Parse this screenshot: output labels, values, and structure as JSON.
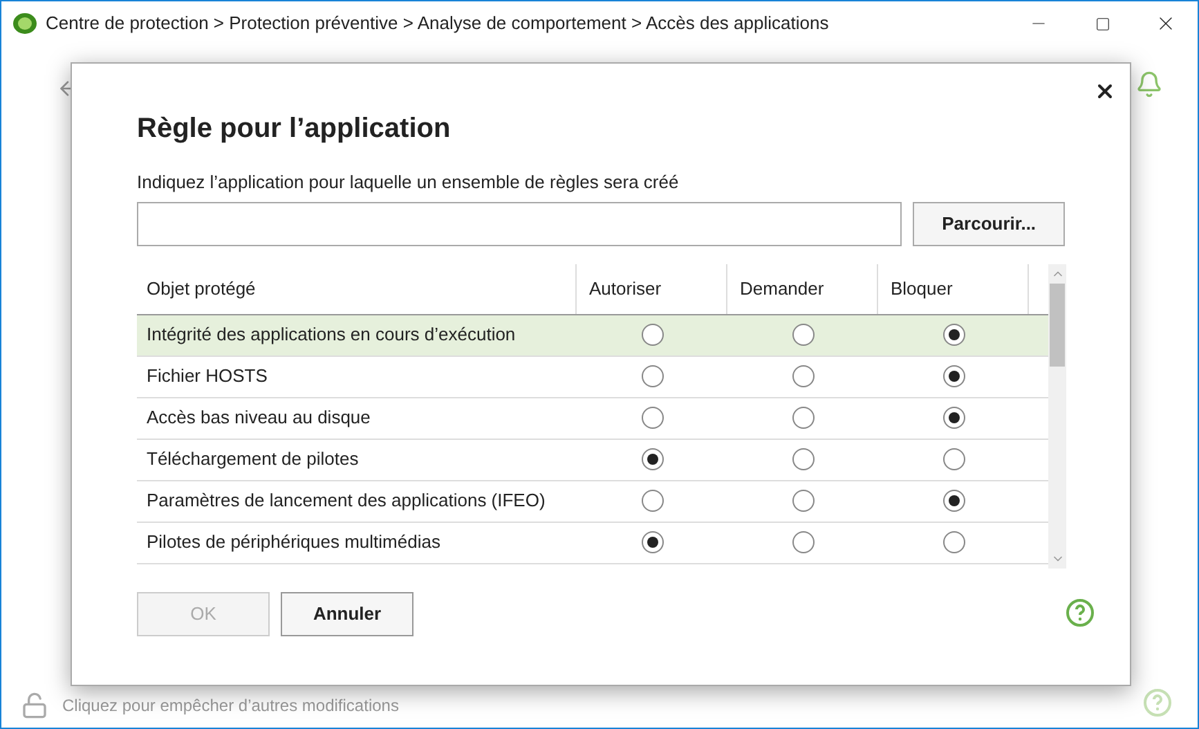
{
  "window": {
    "title": "Centre de protection > Protection préventive > Analyse de comportement > Accès des applications"
  },
  "status_bar": {
    "text": "Cliquez pour empêcher d’autres modifications"
  },
  "dialog": {
    "title": "Règle pour l’application",
    "prompt": "Indiquez l’application pour laquelle un ensemble de règles sera créé",
    "browse_button": "Parcourir...",
    "table": {
      "columns": [
        "Objet protégé",
        "Autoriser",
        "Demander",
        "Bloquer"
      ],
      "rows": [
        {
          "name": "Intégrité des applications en cours d’exécution",
          "selected": true,
          "choices": [
            {
              "selected": false
            },
            {
              "selected": false
            },
            {
              "selected": true
            }
          ]
        },
        {
          "name": "Fichier HOSTS",
          "selected": false,
          "choices": [
            {
              "selected": false
            },
            {
              "selected": false
            },
            {
              "selected": true
            }
          ]
        },
        {
          "name": "Accès bas niveau au disque",
          "selected": false,
          "choices": [
            {
              "selected": false
            },
            {
              "selected": false
            },
            {
              "selected": true
            }
          ]
        },
        {
          "name": "Téléchargement de pilotes",
          "selected": false,
          "choices": [
            {
              "selected": true
            },
            {
              "selected": false
            },
            {
              "selected": false
            }
          ]
        },
        {
          "name": "Paramètres de lancement des applications (IFEO)",
          "selected": false,
          "choices": [
            {
              "selected": false
            },
            {
              "selected": false
            },
            {
              "selected": true
            }
          ]
        },
        {
          "name": "Pilotes de périphériques multimédias",
          "selected": false,
          "choices": [
            {
              "selected": true
            },
            {
              "selected": false
            },
            {
              "selected": false
            }
          ]
        }
      ]
    },
    "buttons": [
      {
        "label": "OK",
        "disabled": true
      },
      {
        "label": "Annuler",
        "disabled": false
      }
    ]
  }
}
